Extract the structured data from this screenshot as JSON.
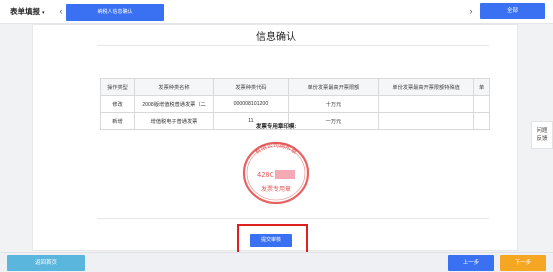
{
  "header": {
    "menu_title": "表单填报",
    "menu_caret": "▾",
    "prev_arrow": "‹",
    "next_arrow": "›",
    "active_tab": "纳税人信息确认",
    "all_button": "全部"
  },
  "main": {
    "title": "信息确认",
    "table": {
      "headers": [
        "操作类型",
        "发票种类名称",
        "发票种类代码",
        "单份发票最高开票限额",
        "单份发票最高开票限额特殊值",
        "单"
      ],
      "rows": [
        [
          "修改",
          "2008版增值税普通发票（二",
          "000008101200",
          "十万元",
          "",
          ""
        ],
        [
          "新增",
          "增值税电子普通发票",
          "11",
          "一万元",
          "",
          ""
        ]
      ]
    },
    "seal_label": "发票专用章印模:",
    "seal": {
      "ring_text": "有限公司圆形章",
      "tax_id": "420C",
      "bottom_text": "发票专用章",
      "color": "#e04848"
    },
    "submit_button": "提交审核"
  },
  "side_help": {
    "line1": "问题",
    "line2": "反馈"
  },
  "footer": {
    "return_button": "返回首页",
    "prev_button": "上一步",
    "next_button": "下一步"
  }
}
